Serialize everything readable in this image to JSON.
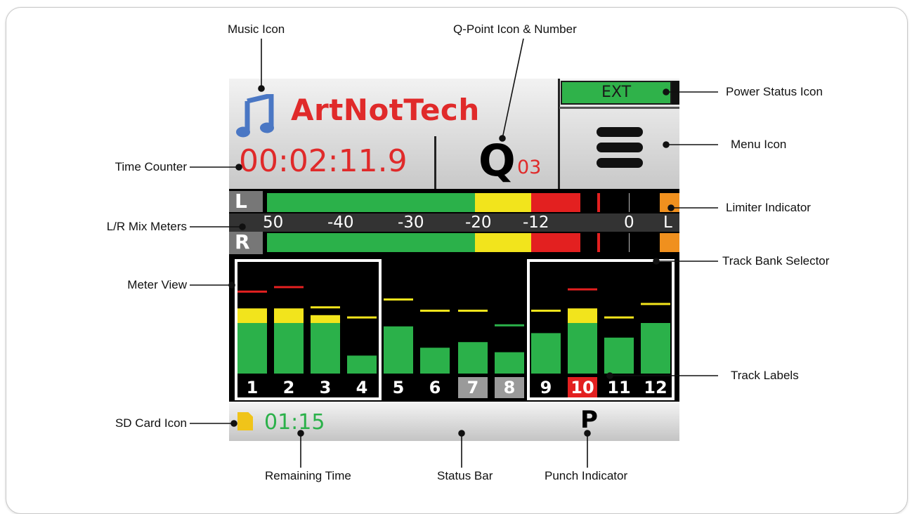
{
  "callouts": {
    "music_icon": "Music Icon",
    "qpoint": "Q-Point Icon & Number",
    "power_status": "Power Status Icon",
    "menu_icon": "Menu Icon",
    "time_counter": "Time Counter",
    "mix_meters": "L/R Mix Meters",
    "limiter": "Limiter Indicator",
    "track_bank": "Track Bank Selector",
    "meter_view": "Meter View",
    "track_labels": "Track Labels",
    "sd_card": "SD Card Icon",
    "remaining_time": "Remaining Time",
    "status_bar": "Status Bar",
    "punch": "Punch Indicator"
  },
  "device": {
    "project_name": "ArtNotTech",
    "time_counter": "00:02:11.9",
    "q_letter": "Q",
    "q_number": "03",
    "power_label": "EXT",
    "mix": {
      "left_label": "L",
      "right_label": "R",
      "scale_ticks": [
        "50",
        "-40",
        "-30",
        "-20",
        "-12",
        "0",
        "L"
      ],
      "level_fraction": 0.76
    },
    "tracks": [
      {
        "label": "1",
        "level": 0.45,
        "peak_yellow": 0.58,
        "hold": 0.72,
        "hold_color": "#e32020",
        "label_bg": "#000000"
      },
      {
        "label": "2",
        "level": 0.45,
        "peak_yellow": 0.58,
        "hold": 0.76,
        "hold_color": "#e32020",
        "label_bg": "#000000"
      },
      {
        "label": "3",
        "level": 0.45,
        "peak_yellow": 0.52,
        "hold": 0.58,
        "hold_color": "#f2e41c",
        "label_bg": "#000000"
      },
      {
        "label": "4",
        "level": 0.16,
        "peak_yellow": 0.16,
        "hold": 0.49,
        "hold_color": "#f2e41c",
        "label_bg": "#000000"
      },
      {
        "label": "5",
        "level": 0.42,
        "peak_yellow": 0.42,
        "hold": 0.65,
        "hold_color": "#f2e41c",
        "label_bg": "#000000"
      },
      {
        "label": "6",
        "level": 0.23,
        "peak_yellow": 0.23,
        "hold": 0.55,
        "hold_color": "#f2e41c",
        "label_bg": "#000000"
      },
      {
        "label": "7",
        "level": 0.28,
        "peak_yellow": 0.28,
        "hold": 0.55,
        "hold_color": "#f2e41c",
        "label_bg": "#9a9a9a"
      },
      {
        "label": "8",
        "level": 0.19,
        "peak_yellow": 0.19,
        "hold": 0.42,
        "hold_color": "#2bb14a",
        "label_bg": "#9a9a9a"
      },
      {
        "label": "9",
        "level": 0.36,
        "peak_yellow": 0.36,
        "hold": 0.55,
        "hold_color": "#f2e41c",
        "label_bg": "#000000"
      },
      {
        "label": "10",
        "level": 0.45,
        "peak_yellow": 0.58,
        "hold": 0.74,
        "hold_color": "#e32020",
        "label_bg": "#e32020"
      },
      {
        "label": "11",
        "level": 0.32,
        "peak_yellow": 0.32,
        "hold": 0.49,
        "hold_color": "#f2e41c",
        "label_bg": "#000000"
      },
      {
        "label": "12",
        "level": 0.45,
        "peak_yellow": 0.45,
        "hold": 0.61,
        "hold_color": "#f2e41c",
        "label_bg": "#000000"
      }
    ],
    "remaining_time": "01:15",
    "punch": "P"
  },
  "colors": {
    "meter_green": "#2bb14a",
    "meter_yellow": "#f2e41c",
    "meter_red": "#e32020",
    "limiter_orange": "#f0901e",
    "accent_red": "#e02a2a",
    "note_blue": "#4a77c4"
  }
}
